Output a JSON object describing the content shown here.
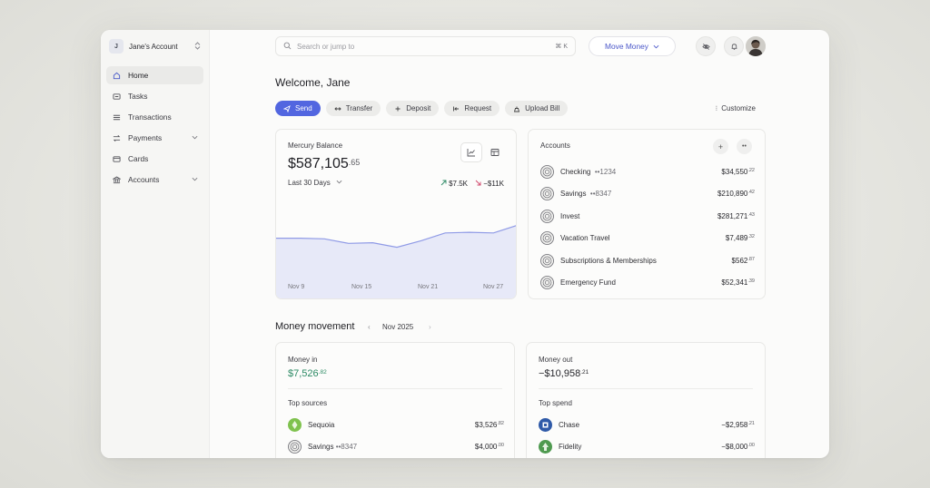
{
  "sidebar": {
    "account": {
      "initial": "J",
      "name": "Jane's Account"
    },
    "items": [
      {
        "label": "Home",
        "icon": "home-icon"
      },
      {
        "label": "Tasks",
        "icon": "tasks-icon"
      },
      {
        "label": "Transactions",
        "icon": "list-icon"
      },
      {
        "label": "Payments",
        "icon": "arrows-icon"
      },
      {
        "label": "Cards",
        "icon": "card-icon"
      },
      {
        "label": "Accounts",
        "icon": "bank-icon"
      }
    ]
  },
  "topbar": {
    "search_placeholder": "Search or jump to",
    "shortcut": "⌘  K",
    "move_money": "Move Money"
  },
  "welcome": "Welcome, Jane",
  "actions": {
    "send": "Send",
    "transfer": "Transfer",
    "deposit": "Deposit",
    "request": "Request",
    "upload_bill": "Upload Bill",
    "customize": "Customize"
  },
  "balance": {
    "label": "Mercury Balance",
    "amount_main": "$587,105",
    "amount_cents": ".65",
    "range": "Last 30 Days",
    "delta_in": "$7.5K",
    "delta_out": "−$11K"
  },
  "chart_data": {
    "type": "area",
    "x": [
      0,
      3,
      6,
      9,
      12,
      15,
      18,
      21,
      24,
      27,
      30
    ],
    "values": [
      0.52,
      0.52,
      0.51,
      0.44,
      0.45,
      0.38,
      0.48,
      0.6,
      0.61,
      0.6,
      0.72
    ],
    "x_tick_labels": [
      "Nov 9",
      "Nov 15",
      "Nov 21",
      "Nov 27"
    ],
    "ylim": [
      0,
      1
    ],
    "colors": {
      "line": "#8f9ae6",
      "fill": "#e7e9f8"
    }
  },
  "accounts": {
    "title": "Accounts",
    "rows": [
      {
        "name": "Checking",
        "mask": "••1234",
        "amount": "$34,550",
        "cents": ".22"
      },
      {
        "name": "Savings",
        "mask": "••8347",
        "amount": "$210,890",
        "cents": ".42"
      },
      {
        "name": "Invest",
        "mask": "",
        "amount": "$281,271",
        "cents": ".43"
      },
      {
        "name": "Vacation Travel",
        "mask": "",
        "amount": "$7,489",
        "cents": ".32"
      },
      {
        "name": "Subscriptions & Memberships",
        "mask": "",
        "amount": "$562",
        "cents": ".87"
      },
      {
        "name": "Emergency Fund",
        "mask": "",
        "amount": "$52,341",
        "cents": ".39"
      }
    ]
  },
  "money_movement": {
    "title": "Money movement",
    "month": "Nov 2025",
    "money_in": {
      "label": "Money in",
      "amount": "$7,526",
      "cents": ".82",
      "sub_label": "Top sources",
      "rows": [
        {
          "name": "Sequoia",
          "mask": "",
          "amount": "$3,526",
          "cents": ".82"
        },
        {
          "name": "Savings",
          "mask": "••8347",
          "amount": "$4,000",
          "cents": ".00"
        }
      ]
    },
    "money_out": {
      "label": "Money out",
      "amount": "−$10,958",
      "cents": ".21",
      "sub_label": "Top spend",
      "rows": [
        {
          "name": "Chase",
          "amount": "−$2,958",
          "cents": ".21"
        },
        {
          "name": "Fidelity",
          "amount": "−$8,000",
          "cents": ".00"
        }
      ]
    }
  },
  "colors": {
    "accent": "#5266e0",
    "positive": "#2c8a64",
    "negative": "#d0466b"
  }
}
